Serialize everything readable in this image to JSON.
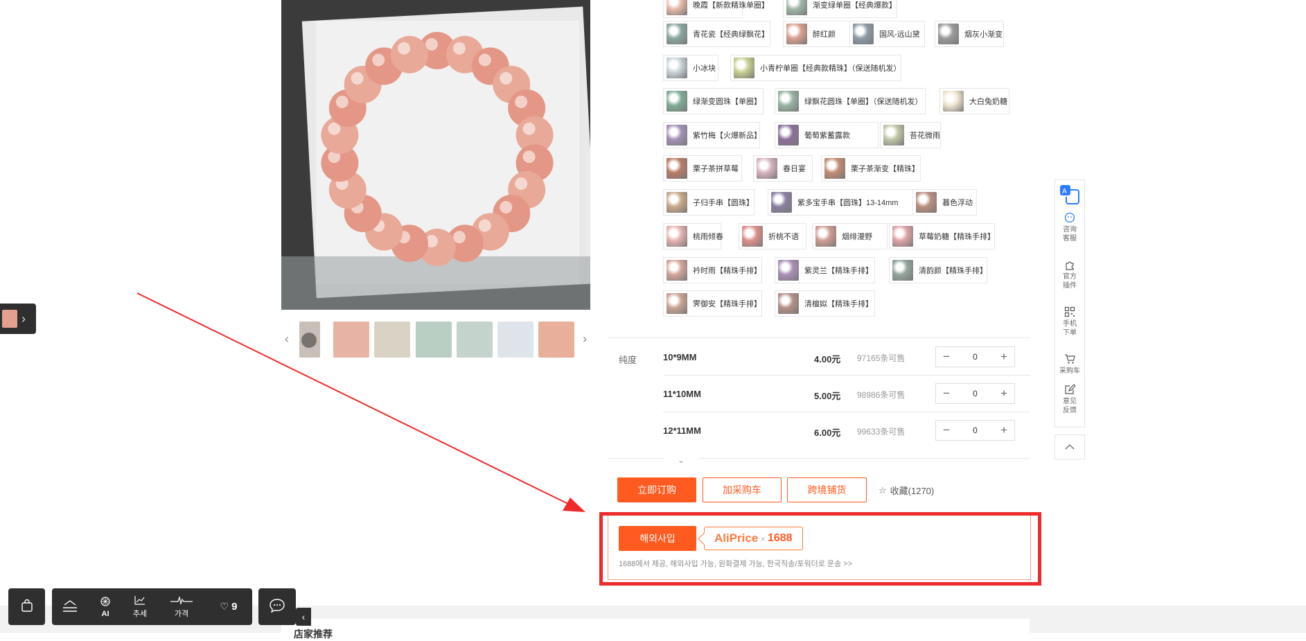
{
  "variants": [
    {
      "label": "晚霞【新款精珠单圈】",
      "color": "#e7b9a8"
    },
    {
      "label": "渐变绿单圈【经典爆款】",
      "color": "#9fb8a8"
    },
    {
      "label": "青花瓷【经典绿飘花】",
      "color": "#8aa7a0"
    },
    {
      "label": "醉红颜",
      "color": "#d9a08f"
    },
    {
      "label": "国风-远山黛",
      "color": "#8d9aa6"
    },
    {
      "label": "烟灰小渐变",
      "color": "#9a9a9a"
    },
    {
      "label": "小冰块",
      "color": "#c9d4d8"
    },
    {
      "label": "小青柠单圈【经典款精珠】（保送随机发）",
      "color": "#c7cf8e"
    },
    {
      "label": "绿渐变圆珠【单圈】",
      "color": "#7fae97"
    },
    {
      "label": "绿飘花圆珠【单圈】（保送随机发）",
      "color": "#98b3a3"
    },
    {
      "label": "大白兔奶糖",
      "color": "#efe4cf"
    },
    {
      "label": "紫竹梅【火爆新品】",
      "color": "#a391b5"
    },
    {
      "label": "葡萄紫蓄露款",
      "color": "#8b6f9a"
    },
    {
      "label": "苔花微雨",
      "color": "#c0c7a8"
    },
    {
      "label": "栗子茶拼草莓",
      "color": "#b87a66"
    },
    {
      "label": "春日宴",
      "color": "#d8b3c0"
    },
    {
      "label": "栗子茶渐变【精珠】",
      "color": "#c08b73"
    },
    {
      "label": "子归手串【圆珠】",
      "color": "#c9a98a"
    },
    {
      "label": "紫多宝手串【圆珠】13-14mm",
      "color": "#8a7fa0"
    },
    {
      "label": "暮色浮动",
      "color": "#b98e7e"
    },
    {
      "label": "桃雨倾春",
      "color": "#e5b3b0"
    },
    {
      "label": "折桃不语",
      "color": "#dc8f8a"
    },
    {
      "label": "烟绯漫野",
      "color": "#cf9c92"
    },
    {
      "label": "草莓奶糖【精珠手排】",
      "color": "#e0a3a6"
    },
    {
      "label": "衿时雨【精珠手排】",
      "color": "#d4a69c"
    },
    {
      "label": "紫灵兰【精珠手排】",
      "color": "#a990b6"
    },
    {
      "label": "清韵颜【精珠手排】",
      "color": "#92a59b"
    },
    {
      "label": "霁御安【精珠手排】",
      "color": "#c9a494"
    },
    {
      "label": "清檀姒【精珠手排】",
      "color": "#b48f86"
    }
  ],
  "spec": {
    "label": "纯度",
    "rows": [
      {
        "size": "10*9MM",
        "price": "4.00元",
        "stock": "97165条可售",
        "qty": "0"
      },
      {
        "size": "11*10MM",
        "price": "5.00元",
        "stock": "98986条可售",
        "qty": "0"
      },
      {
        "size": "12*11MM",
        "price": "6.00元",
        "stock": "99633条可售",
        "qty": "0"
      }
    ]
  },
  "actions": {
    "buy_now": "立即订购",
    "add_cart": "加采购车",
    "cross_border": "跨境铺货",
    "favorite": "收藏(1270)"
  },
  "aliprice": {
    "button": "해외사입",
    "brand": "AliPrice",
    "times": "×",
    "partner": "1688",
    "note": "1688에서 제공, 해외사입 가능, 원화결제 가능, 한국직송/포워더로 운송 >>"
  },
  "sidebar": {
    "items": [
      {
        "label": "咨询客服",
        "icon": "chat-face-icon"
      },
      {
        "label": "官方插件",
        "icon": "puzzle-icon"
      },
      {
        "label": "手机下单",
        "icon": "qr-icon"
      },
      {
        "label": "采购车",
        "icon": "cart-icon"
      },
      {
        "label": "意见反馈",
        "icon": "edit-icon"
      }
    ]
  },
  "toolbar": {
    "ai": "AI",
    "trend": "추세",
    "price": "가격",
    "fav_count": "9"
  },
  "bottom": {
    "title": "店家推荐"
  },
  "colors": {
    "accent": "#ff5a1f",
    "highlight": "#ee2b2b",
    "toolbar": "#2f2f2f"
  }
}
